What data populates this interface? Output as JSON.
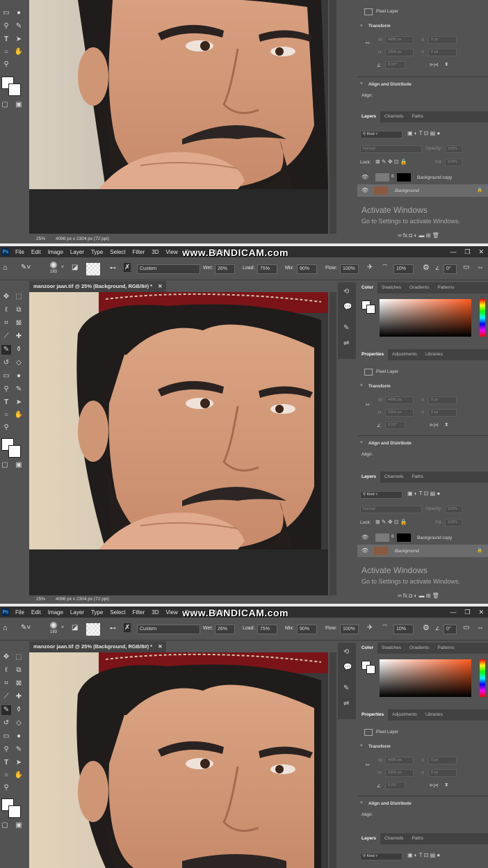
{
  "watermark": "www.BANDICAM.com",
  "menu": [
    "File",
    "Edit",
    "Image",
    "Layer",
    "Type",
    "Select",
    "Filter",
    "3D",
    "View",
    "Plugins",
    "Window"
  ],
  "options": {
    "brush_size": "193",
    "preset": "Custom",
    "wet_label": "Wet:",
    "wet_value": "26%",
    "load_label": "Load:",
    "load_value": "75%",
    "mix_label": "Mix:",
    "mix_value": "90%",
    "flow_label": "Flow:",
    "flow_value": "100%",
    "smoothing_value": "10%",
    "angle_value": "0°"
  },
  "document": {
    "tab_title": "manzoor jaan.tif @ 25% (Background, RGB/8#) *",
    "zoom": "25%",
    "doc_size": "4096 px x 2304 px (72 ppi)"
  },
  "color_panel": {
    "tabs": [
      "Color",
      "Swatches",
      "Gradients",
      "Patterns"
    ]
  },
  "properties": {
    "tabs": [
      "Properties",
      "Adjustments",
      "Libraries"
    ],
    "kind": "Pixel Layer",
    "transform_label": "Transform",
    "w_label": "W",
    "w_value": "4096 px",
    "h_label": "H",
    "h_value": "2304 px",
    "x_label": "X",
    "x_value": "0 px",
    "y_label": "Y",
    "y_value": "0 px",
    "angle_value": "0.00°",
    "align_label": "Align and Distribute",
    "align_sub": "Align:"
  },
  "layers_panel": {
    "tabs": [
      "Layers",
      "Channels",
      "Paths"
    ],
    "filter": "Kind",
    "blend": "Normal",
    "opacity_label": "Opacity:",
    "opacity_value": "100%",
    "lock_label": "Lock:",
    "fill_label": "Fill:",
    "fill_value": "100%",
    "layers": [
      {
        "name": "Background copy",
        "selected": false
      },
      {
        "name": "Background",
        "selected": true
      }
    ]
  },
  "activate": {
    "title": "Activate Windows",
    "subtitle": "Go to Settings to activate Windows."
  }
}
